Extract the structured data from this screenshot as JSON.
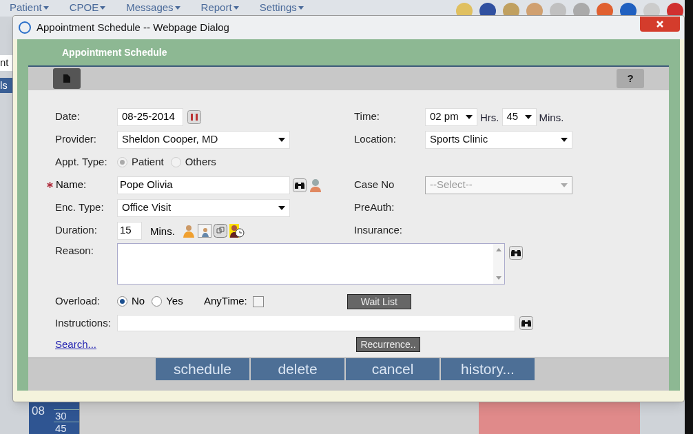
{
  "background": {
    "menu": [
      "Patient",
      "CPOE",
      "Messages",
      "Report",
      "Settings"
    ],
    "left_texts": [
      "nt",
      "ls"
    ],
    "grid_hour": "08",
    "grid_minutes": [
      "30",
      "45"
    ]
  },
  "dialog": {
    "title": "Appointment Schedule -- Webpage Dialog",
    "header": "Appointment Schedule",
    "help": "?"
  },
  "form": {
    "date": {
      "label": "Date:",
      "value": "08-25-2014"
    },
    "time": {
      "label": "Time:",
      "hour": "02 pm",
      "hrs_label": "Hrs.",
      "minute": "45",
      "mins_label": "Mins."
    },
    "provider": {
      "label": "Provider:",
      "value": "Sheldon Cooper, MD"
    },
    "location": {
      "label": "Location:",
      "value": "Sports Clinic"
    },
    "appt_type": {
      "label": "Appt. Type:",
      "disabled": true,
      "options": [
        {
          "label": "Patient",
          "selected": true
        },
        {
          "label": "Others",
          "selected": false
        }
      ]
    },
    "name": {
      "label": "Name:",
      "required": true,
      "value": "Pope Olivia"
    },
    "case_no": {
      "label": "Case No",
      "value": "--Select--",
      "disabled": true
    },
    "enc_type": {
      "label": "Enc. Type:",
      "value": "Office Visit"
    },
    "preauth": {
      "label": "PreAuth:"
    },
    "duration": {
      "label": "Duration:",
      "value": "15",
      "unit": "Mins."
    },
    "insurance": {
      "label": "Insurance:"
    },
    "reason": {
      "label": "Reason:"
    },
    "overload": {
      "label": "Overload:",
      "options": [
        {
          "label": "No",
          "selected": true
        },
        {
          "label": "Yes",
          "selected": false
        }
      ]
    },
    "anytime": {
      "label": "AnyTime:",
      "checked": false
    },
    "wait_list": "Wait List",
    "instructions": {
      "label": "Instructions:"
    },
    "search_link": "Search...",
    "recurrence": "Recurrence.."
  },
  "actions": [
    "schedule",
    "delete",
    "cancel",
    "history..."
  ]
}
